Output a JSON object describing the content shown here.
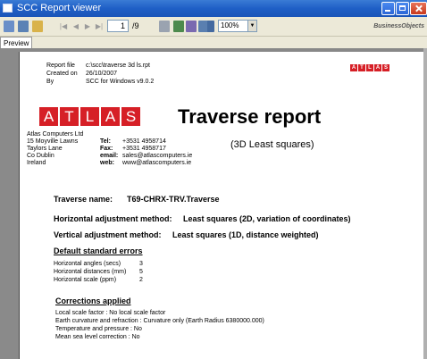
{
  "window": {
    "title": "SCC Report viewer"
  },
  "toolbar": {
    "page_current": "1",
    "page_total": "/9",
    "zoom": "100%"
  },
  "branding": {
    "vendor": "BusinessObjects"
  },
  "tabs": [
    {
      "label": "Preview"
    }
  ],
  "report": {
    "meta": [
      {
        "label": "Report file",
        "value": "c:\\scc\\traverse 3d ls.rpt"
      },
      {
        "label": "Created on",
        "value": "26/10/2007"
      },
      {
        "label": "By",
        "value": "SCC for Windows v9.0.2"
      }
    ],
    "logo_letters": [
      "A",
      "T",
      "L",
      "A",
      "S"
    ],
    "title": "Traverse report",
    "subtitle": "(3D Least squares)",
    "company": {
      "name": "Atlas Computers Ltd",
      "address": [
        "15 Moyville Lawns",
        "Taylors Lane",
        "Co Dublin",
        "Ireland"
      ],
      "contact_labels": [
        "Tel:",
        "Fax:",
        "email:",
        "web:"
      ],
      "contact_values": [
        "+3531 4958714",
        "+3531 4958717",
        "sales@atlascomputers.ie",
        "www@atlascomputers.ie"
      ]
    },
    "traverse_name_label": "Traverse name:",
    "traverse_name": "T69-CHRX-TRV.Traverse",
    "horizontal_method_label": "Horizontal adjustment method:",
    "horizontal_method": "Least squares (2D, variation of coordinates)",
    "vertical_method_label": "Vertical adjustment method:",
    "vertical_method": "Least squares (1D, distance weighted)",
    "default_errors_heading": "Default standard errors",
    "default_errors": [
      {
        "label": "Horizontal angles (secs)",
        "value": "3"
      },
      {
        "label": "Horizontal distances (mm)",
        "value": "5"
      },
      {
        "label": "Horizontal scale (ppm)",
        "value": "2"
      }
    ],
    "corrections_heading": "Corrections applied",
    "corrections": [
      "Local scale factor : No local scale factor",
      "Earth curvature and refraction : Curvature only  (Earth Radius 6380000.000)",
      "Temperature and pressure : No",
      "Mean sea level correction : No"
    ]
  }
}
